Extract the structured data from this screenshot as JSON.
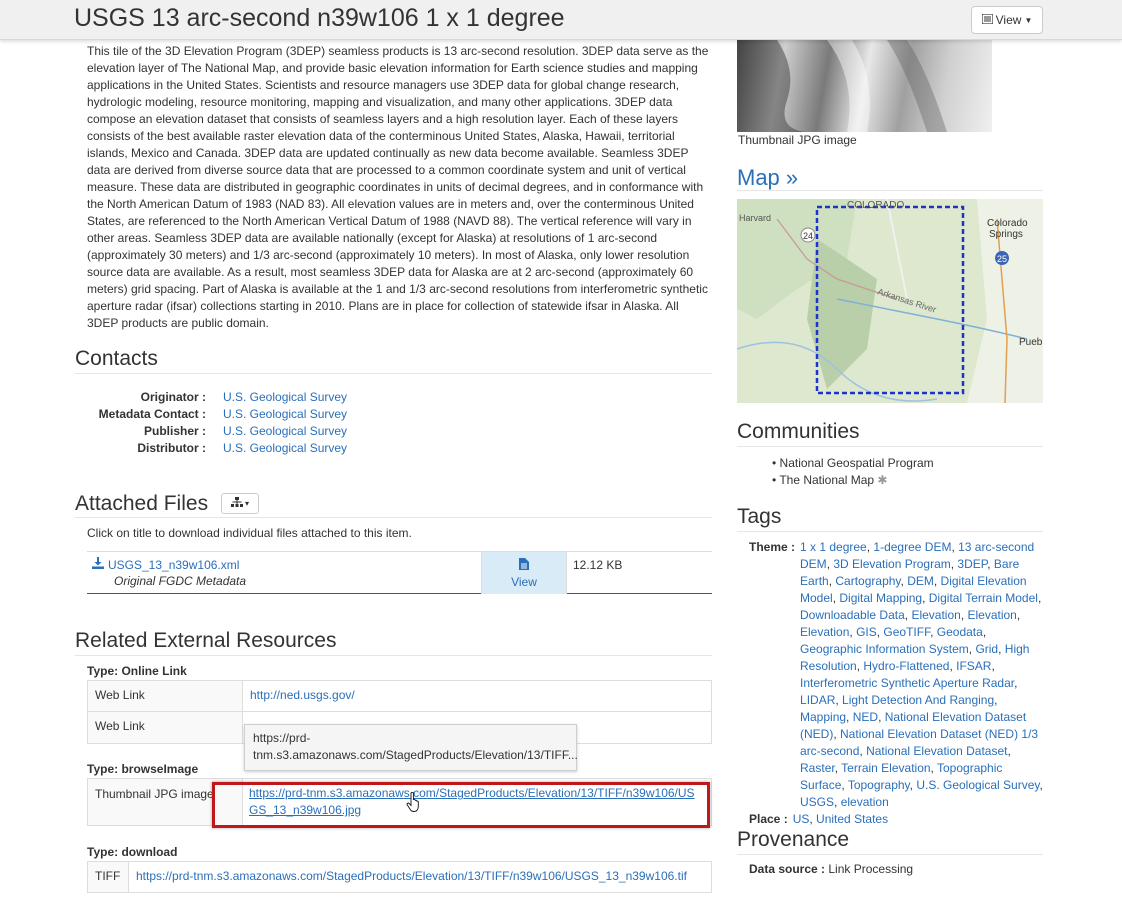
{
  "header": {
    "title": "USGS 13 arc-second n39w106 1 x 1 degree",
    "view_button": "View"
  },
  "description": "This tile of the 3D Elevation Program (3DEP) seamless products is 13 arc-second resolution. 3DEP data serve as the elevation layer of The National Map, and provide basic elevation information for Earth science studies and mapping applications in the United States. Scientists and resource managers use 3DEP data for global change research, hydrologic modeling, resource monitoring, mapping and visualization, and many other applications. 3DEP data compose an elevation dataset that consists of seamless layers and a high resolution layer. Each of these layers consists of the best available raster elevation data of the conterminous United States, Alaska, Hawaii, territorial islands, Mexico and Canada. 3DEP data are updated continually as new data become available. Seamless 3DEP data are derived from diverse source data that are processed to a common coordinate system and unit of vertical measure. These data are distributed in geographic coordinates in units of decimal degrees, and in conformance with the North American Datum of 1983 (NAD 83). All elevation values are in meters and, over the conterminous United States, are referenced to the North American Vertical Datum of 1988 (NAVD 88). The vertical reference will vary in other areas. Seamless 3DEP data are available nationally (except for Alaska) at resolutions of 1 arc-second (approximately 30 meters) and 1/3 arc-second (approximately 10 meters). In most of Alaska, only lower resolution source data are available. As a result, most seamless 3DEP data for Alaska are at 2 arc-second (approximately 60 meters) grid spacing. Part of Alaska is available at the 1 and 1/3 arc-second resolutions from interferometric synthetic aperture radar (ifsar) collections starting in 2010. Plans are in place for collection of statewide ifsar in Alaska. All 3DEP products are public domain.",
  "contacts": {
    "heading": "Contacts",
    "rows": [
      {
        "label": "Originator :",
        "value": "U.S. Geological Survey"
      },
      {
        "label": "Metadata Contact :",
        "value": "U.S. Geological Survey"
      },
      {
        "label": "Publisher :",
        "value": "U.S. Geological Survey"
      },
      {
        "label": "Distributor :",
        "value": "U.S. Geological Survey"
      }
    ]
  },
  "files": {
    "heading": "Attached Files",
    "note": "Click on title to download individual files attached to this item.",
    "file_name": "USGS_13_n39w106.xml",
    "file_desc": "Original FGDC Metadata",
    "view_label": "View",
    "size": "12.12 KB"
  },
  "resources": {
    "heading": "Related External Resources",
    "online_type": "Type: Online Link",
    "online_rows": [
      {
        "label": "Web Link",
        "value": "http://ned.usgs.gov/"
      },
      {
        "label": "Web Link",
        "value": ""
      }
    ],
    "tooltip": "https://prd-tnm.s3.amazonaws.com/StagedProducts/Elevation/13/TIFF...",
    "browse_type": "Type: browseImage",
    "browse_label": "Thumbnail JPG image",
    "browse_url": "https://prd-tnm.s3.amazonaws.com/StagedProducts/Elevation/13/TIFF/n39w106/USGS_13_n39w106.jpg",
    "download_type": "Type: download",
    "download_label": "TIFF",
    "download_url": "https://prd-tnm.s3.amazonaws.com/StagedProducts/Elevation/13/TIFF/n39w106/USGS_13_n39w106.tif"
  },
  "sidebar": {
    "thumb_caption": "Thumbnail JPG image",
    "map_heading": "Map »",
    "map_labels": {
      "state": "COLORADO",
      "city1": "Colorado",
      "city1b": "Springs",
      "river": "Arkansas River",
      "pueblo": "Pueb",
      "harvard": "Harvard",
      "route24": "24",
      "route25": "25"
    },
    "communities_heading": "Communities",
    "communities": [
      "National Geospatial Program",
      "The National Map"
    ],
    "tags_heading": "Tags",
    "theme_label": "Theme :",
    "theme_tags": [
      "1 x 1 degree",
      "1-degree DEM",
      "13 arc-second DEM",
      "3D Elevation Program",
      "3DEP",
      "Bare Earth",
      "Cartography",
      "DEM",
      "Digital Elevation Model",
      "Digital Mapping",
      "Digital Terrain Model",
      "Downloadable Data",
      "Elevation",
      "Elevation",
      "Elevation",
      "GIS",
      "GeoTIFF",
      "Geodata",
      "Geographic Information System",
      "Grid",
      "High Resolution",
      "Hydro-Flattened",
      "IFSAR",
      "Interferometric Synthetic Aperture Radar",
      "LIDAR",
      "Light Detection And Ranging",
      "Mapping",
      "NED",
      "National Elevation Dataset (NED)",
      "National Elevation Dataset (NED) 1/3 arc-second",
      "National Elevation Dataset",
      "Raster",
      "Terrain Elevation",
      "Topographic Surface",
      "Topography",
      "U.S. Geological Survey",
      "USGS",
      "elevation"
    ],
    "place_label": "Place :",
    "place_tags": [
      "US",
      "United States"
    ],
    "provenance_heading": "Provenance",
    "data_source_label": "Data source :",
    "data_source_value": "Link Processing"
  },
  "colors": {
    "link": "#2a6fba",
    "highlight": "#c0171b",
    "view_cell": "#d9ebf7"
  }
}
